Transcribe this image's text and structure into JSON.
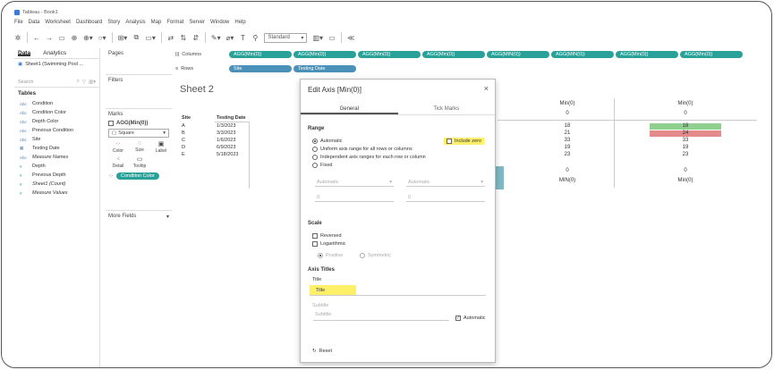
{
  "window": {
    "title": "Tableau - Book1"
  },
  "menu": [
    "File",
    "Data",
    "Worksheet",
    "Dashboard",
    "Story",
    "Analysis",
    "Map",
    "Format",
    "Server",
    "Window",
    "Help"
  ],
  "toolbar": {
    "standard": "Standard"
  },
  "leftpane": {
    "tabs": [
      "Data",
      "Analytics"
    ],
    "datasource": "Sheet1 (Swimming Pool ...",
    "search_placeholder": "Search",
    "tables_label": "Tables",
    "fields": [
      {
        "type": "Abc",
        "name": "Condition",
        "italic": false,
        "measure": false
      },
      {
        "type": "Abc",
        "name": "Condition Color",
        "italic": false,
        "measure": false
      },
      {
        "type": "Abc",
        "name": "Depth Color",
        "italic": false,
        "measure": false
      },
      {
        "type": "Abc",
        "name": "Previous Condition",
        "italic": false,
        "measure": false
      },
      {
        "type": "Abc",
        "name": "Site",
        "italic": false,
        "measure": false
      },
      {
        "type": "▦",
        "name": "Testing Date",
        "italic": false,
        "measure": false
      },
      {
        "type": "Abc",
        "name": "Measure Names",
        "italic": true,
        "measure": false
      },
      {
        "type": "#",
        "name": "Depth",
        "italic": false,
        "measure": true
      },
      {
        "type": "#",
        "name": "Previous Depth",
        "italic": false,
        "measure": true
      },
      {
        "type": "#",
        "name": "Sheet1 (Count)",
        "italic": true,
        "measure": true
      },
      {
        "type": "#",
        "name": "Measure Values",
        "italic": true,
        "measure": true
      }
    ]
  },
  "midpane": {
    "pages": "Pages",
    "filters": "Filters",
    "marks": "Marks",
    "marks_field": "AGG(Min(0))",
    "mark_type": "Square",
    "buttons": [
      "Color",
      "Size",
      "Label",
      "Detail",
      "Tooltip"
    ],
    "color_pill": "Condition Color",
    "more_fields": "More Fields"
  },
  "shelves": {
    "columns_label": "Columns",
    "rows_label": "Rows",
    "columns": [
      "AGG(Min(0))",
      "AGG(Min(0))",
      "AGG(Min(0))",
      "AGG(Min(0))",
      "AGG(MIN(0))",
      "AGG(MIN(0))",
      "AGG(Min(0))",
      "AGG(Min(0))"
    ],
    "rows": [
      "Site",
      "Testing Date"
    ]
  },
  "sheet": {
    "title": "Sheet 2",
    "headers": [
      "Site",
      "Testing Date"
    ],
    "rows": [
      {
        "site": "A",
        "date": "1/3/2023"
      },
      {
        "site": "B",
        "date": "3/3/2023"
      },
      {
        "site": "C",
        "date": "1/6/2023"
      },
      {
        "site": "D",
        "date": "6/9/2023"
      },
      {
        "site": "E",
        "date": "5/18/2023"
      }
    ],
    "col1": {
      "header": "Min(0)",
      "zero": "0",
      "values": [
        "18",
        "21",
        "33",
        "19",
        "23"
      ],
      "total_zero": "0",
      "footer": "MIN(0)"
    },
    "col2": {
      "header": "Min(0)",
      "zero": "0",
      "values": [
        "18",
        "24",
        "33",
        "19",
        "23"
      ],
      "total_zero": "0",
      "footer": "Min(0)"
    },
    "colors": {
      "green": "#8fd08f",
      "red": "#e48a8a",
      "teal": "#7fb8c4"
    }
  },
  "dialog": {
    "title": "Edit Axis [Min(0)]",
    "tabs": [
      "General",
      "Tick Marks"
    ],
    "range_label": "Range",
    "range_options": [
      "Automatic",
      "Uniform axis range for all rows or columns",
      "Independent axis ranges for each row or column",
      "Fixed"
    ],
    "include_zero": "Include zero",
    "sel1": "Automatic",
    "sel2": "Automatic",
    "inp1": "0",
    "inp2": "0",
    "scale_label": "Scale",
    "reversed": "Reversed",
    "logarithmic": "Logarithmic",
    "positive": "Positive",
    "symmetric": "Symmetric",
    "axis_titles_label": "Axis Titles",
    "title_label": "Title",
    "title_value": "Title",
    "subtitle_label": "Subtitle",
    "subtitle_placeholder": "Subtitle",
    "automatic": "Automatic",
    "reset": "Reset"
  }
}
